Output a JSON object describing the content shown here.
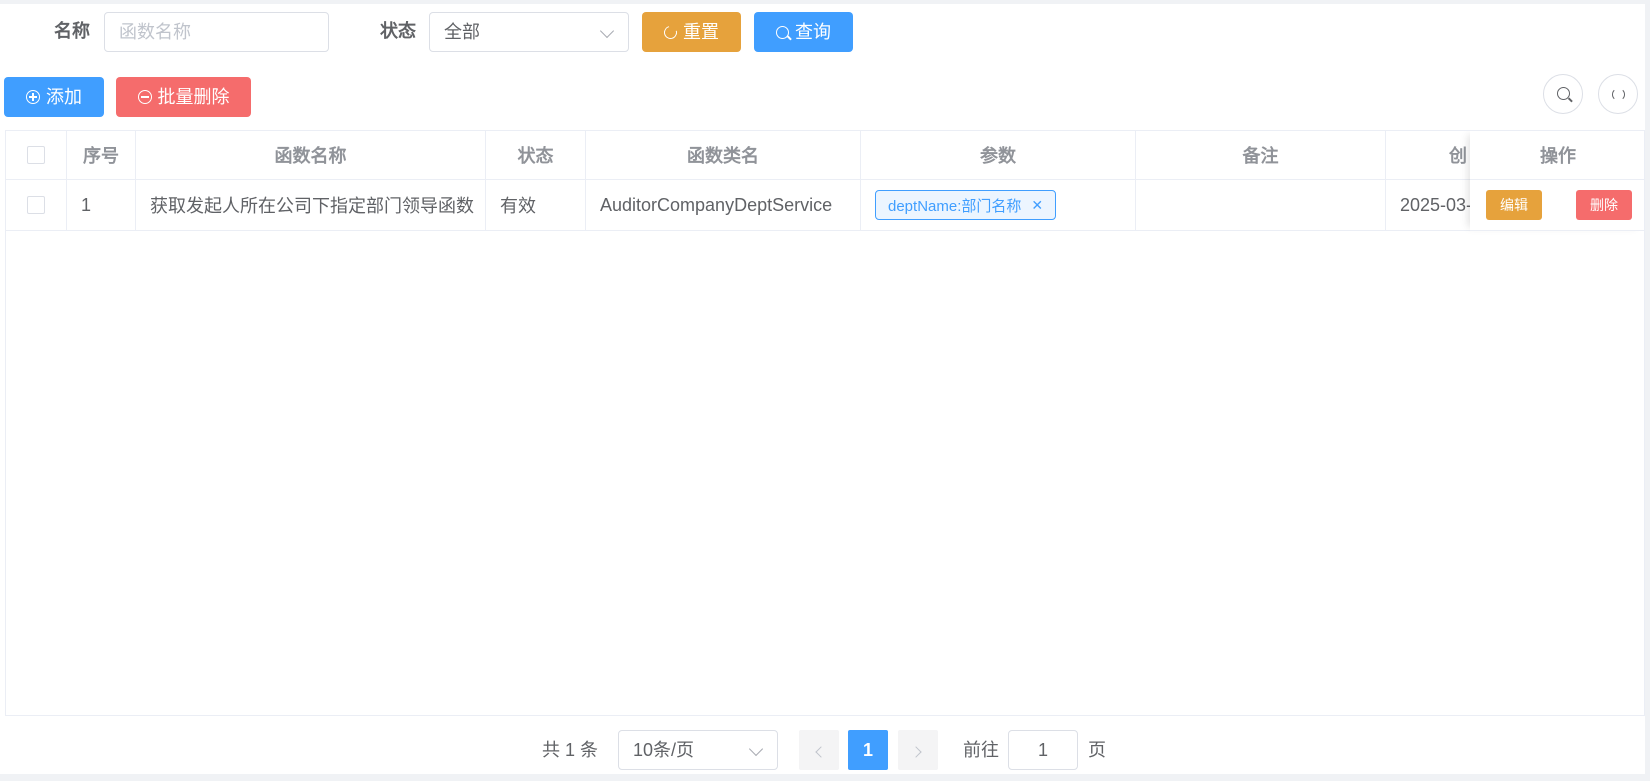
{
  "search_form": {
    "name_label": "名称",
    "name_placeholder": "函数名称",
    "status_label": "状态",
    "status_value": "全部",
    "reset_label": "重置",
    "query_label": "查询"
  },
  "toolbar": {
    "add_label": "添加",
    "batch_delete_label": "批量删除"
  },
  "table": {
    "columns": [
      "序号",
      "函数名称",
      "状态",
      "函数类名",
      "参数",
      "备注",
      "创",
      "操作"
    ],
    "rows": [
      {
        "index": "1",
        "name": "获取发起人所在公司下指定部门领导函数",
        "status": "有效",
        "class_name": "AuditorCompanyDeptService",
        "param_tag": "deptName:部门名称",
        "remark": "",
        "created": "2025-03-",
        "edit_label": "编辑",
        "delete_label": "删除"
      }
    ]
  },
  "pagination": {
    "total_text": "共 1 条",
    "page_size": "10条/页",
    "current_page": "1",
    "goto_label": "前往",
    "goto_value": "1",
    "page_suffix": "页"
  },
  "colors": {
    "primary": "#409eff",
    "warning": "#e6a23c",
    "danger": "#f56c6c"
  },
  "icons": [
    "refresh-icon",
    "search-icon",
    "plus-circle-icon",
    "minus-circle-icon",
    "chevron-down-icon",
    "close-icon",
    "chevron-left-icon",
    "chevron-right-icon"
  ]
}
